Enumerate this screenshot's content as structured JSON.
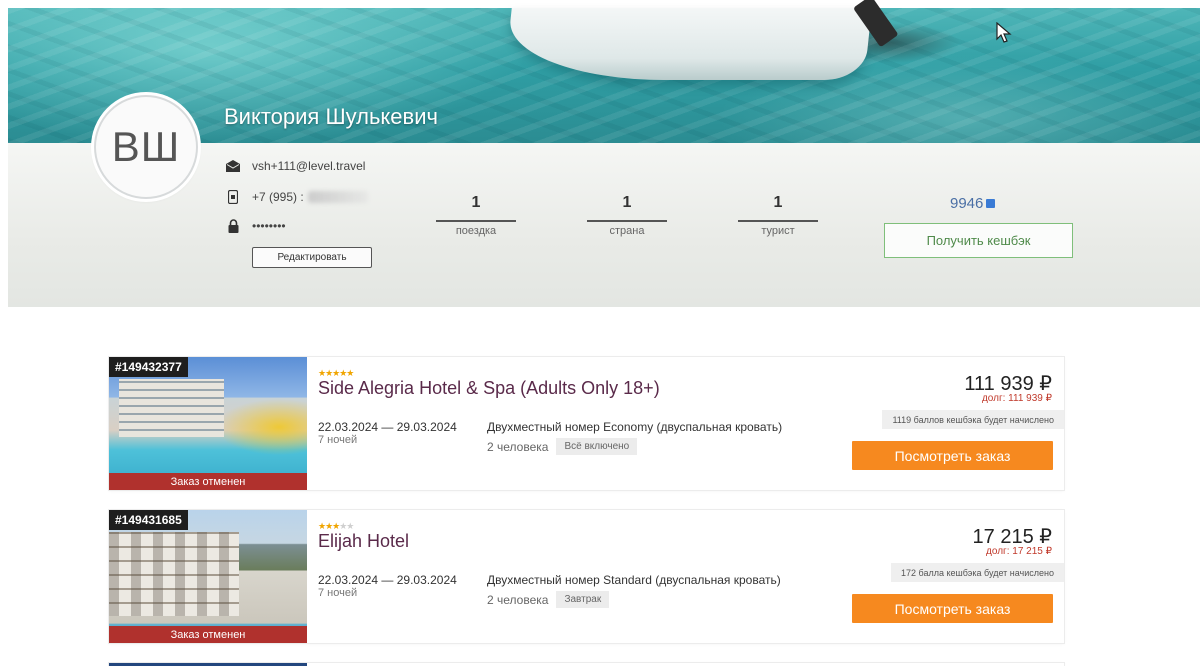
{
  "profile": {
    "initials": "ВШ",
    "name": "Виктория Шулькевич",
    "email": "vsh+111@level.travel",
    "phone": "+7 (995) :",
    "password": "••••••••",
    "edit_label": "Редактировать"
  },
  "stats": {
    "trips": {
      "value": "1",
      "label": "поездка"
    },
    "countries": {
      "value": "1",
      "label": "страна"
    },
    "tourists": {
      "value": "1",
      "label": "турист"
    }
  },
  "cashback": {
    "amount": "9946",
    "button_label": "Получить кешбэк"
  },
  "orders": [
    {
      "id": "#149432377",
      "status": "Заказ отменен",
      "stars": 5,
      "stars_display": {
        "on": "★★★★★",
        "off": ""
      },
      "hotel": "Side Alegria Hotel & Spa (Adults Only 18+)",
      "dates": "22.03.2024 — 29.03.2024",
      "nights": "7 ночей",
      "room": "Двухместный номер Economy (двуспальная кровать)",
      "guests": "2 человека",
      "meal": "Всё включено",
      "price": "111 939 ₽",
      "debt": "долг: 111 939 ₽",
      "cashback_note": "1119 баллов кешбэка будет начислено",
      "button_label": "Посмотреть заказ"
    },
    {
      "id": "#149431685",
      "status": "Заказ отменен",
      "stars": 3,
      "stars_display": {
        "on": "★★★",
        "off": "★★"
      },
      "hotel": "Elijah Hotel",
      "dates": "22.03.2024 — 29.03.2024",
      "nights": "7 ночей",
      "room": "Двухместный номер Standard (двуспальная кровать)",
      "guests": "2 человека",
      "meal": "Завтрак",
      "price": "17 215 ₽",
      "debt": "долг: 17 215 ₽",
      "cashback_note": "172 балла кешбэка будет начислено",
      "button_label": "Посмотреть заказ"
    }
  ],
  "colors": {
    "accent_orange": "#f6891f",
    "cancel_red": "#b0312d",
    "cashback_green": "#7fbf7a",
    "hotel_name": "#5a2a4a",
    "star": "#f0a500"
  }
}
